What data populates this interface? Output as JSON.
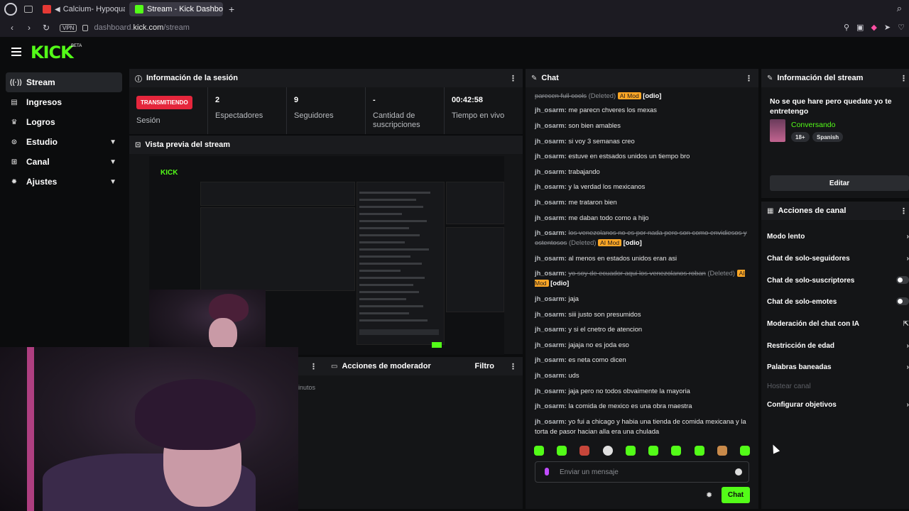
{
  "browser": {
    "tab1": "Calcium- Hypoqua",
    "tab2": "Stream - Kick Dashboard",
    "url_prefix": "dashboard.",
    "url_domain": "kick.com",
    "url_path": "/stream",
    "vpn": "VPN"
  },
  "brand": {
    "logo": "KICK",
    "beta": "BETA",
    "accent": "#53fc18"
  },
  "sidebar": {
    "items": [
      {
        "label": "Stream",
        "icon": "broadcast-icon"
      },
      {
        "label": "Ingresos",
        "icon": "income-icon"
      },
      {
        "label": "Logros",
        "icon": "trophy-icon"
      },
      {
        "label": "Estudio",
        "icon": "studio-icon"
      },
      {
        "label": "Canal",
        "icon": "channel-icon"
      },
      {
        "label": "Ajustes",
        "icon": "gear-icon"
      }
    ]
  },
  "session": {
    "title": "Información de la sesión",
    "live_badge": "TRANSMITIENDO",
    "session_label": "Sesión",
    "viewers_value": "2",
    "viewers_label": "Espectadores",
    "followers_value": "9",
    "followers_label": "Seguidores",
    "subs_value": "-",
    "subs_label": "Cantidad de suscripciones",
    "uptime_value": "00:42:58",
    "uptime_label": "Tiempo en vivo"
  },
  "preview": {
    "title": "Vista previa del stream"
  },
  "moderator": {
    "title": "Acciones de moderador",
    "filter": "Filtro",
    "partial": "inutos"
  },
  "chat": {
    "title": "Chat",
    "messages": [
      {
        "user": "",
        "text": "",
        "deleted": "parecen full cools",
        "deleted_tag": "(Deleted)",
        "aimod": "AI Mod",
        "odio": "[odio]"
      },
      {
        "user": "jh_osarm:",
        "text": "me parecn chveres los mexas"
      },
      {
        "user": "jh_osarm:",
        "text": "son bien amables"
      },
      {
        "user": "jh_osarm:",
        "text": "si voy 3 semanas creo"
      },
      {
        "user": "jh_osarm:",
        "text": "estuve en estsados unidos un tiempo bro"
      },
      {
        "user": "jh_osarm:",
        "text": "trabajando"
      },
      {
        "user": "jh_osarm:",
        "text": "y la verdad los mexicanos"
      },
      {
        "user": "jh_osarm:",
        "text": "me trataron bien"
      },
      {
        "user": "jh_osarm:",
        "text": "me daban todo como a hijo"
      },
      {
        "user": "jh_osarm:",
        "text": "",
        "deleted": "los venezolanos no es por nada pero son como envidiesos y ostentosos",
        "deleted_tag": "(Deleted)",
        "aimod": "AI Mod",
        "odio": "[odio]"
      },
      {
        "user": "jh_osarm:",
        "text": "al menos en estados unidos eran asi"
      },
      {
        "user": "jh_osarm:",
        "text": "",
        "deleted": "yo soy de ecuador aqui los venezolanos roban",
        "deleted_tag": "(Deleted)",
        "aimod": "AI Mod",
        "odio": "[odio]"
      },
      {
        "user": "jh_osarm:",
        "text": "jaja"
      },
      {
        "user": "jh_osarm:",
        "text": "siii justo son presumidos"
      },
      {
        "user": "jh_osarm:",
        "text": "y si el cnetro de atencion"
      },
      {
        "user": "jh_osarm:",
        "text": "jajaja no es joda eso"
      },
      {
        "user": "jh_osarm:",
        "text": "es neta como dicen"
      },
      {
        "user": "jh_osarm:",
        "text": "uds"
      },
      {
        "user": "jh_osarm:",
        "text": "jaja pero no todos obvaimente la mayoria"
      },
      {
        "user": "jh_osarm:",
        "text": "la comida de mexico es una obra maestra"
      },
      {
        "user": "jh_osarm:",
        "text": "yo fui a chicago y habia una tienda de comida mexicana y la torta de pasor hacian alla era una chulada"
      }
    ],
    "input_placeholder": "Enviar un mensaje",
    "send_label": "Chat"
  },
  "stream_info": {
    "title": "Información del stream",
    "stream_title": "No se que hare pero quedate yo te entretengo",
    "category": "Conversando",
    "tag_age": "18+",
    "tag_lang": "Spanish",
    "edit_label": "Editar"
  },
  "channel_actions": {
    "title": "Acciones de canal",
    "items": [
      {
        "label": "Modo lento",
        "control": "arrow"
      },
      {
        "label": "Chat de solo-seguidores",
        "control": "arrow"
      },
      {
        "label": "Chat de solo-suscriptores",
        "control": "toggle"
      },
      {
        "label": "Chat de solo-emotes",
        "control": "toggle"
      },
      {
        "label": "Moderación del chat con IA",
        "control": "arrow"
      },
      {
        "label": "Restricción de edad",
        "control": "arrow"
      },
      {
        "label": "Palabras baneadas",
        "control": "arrow"
      },
      {
        "label": "Hostear canal",
        "control": "none"
      },
      {
        "label": "Configurar objetivos",
        "control": "arrow"
      }
    ]
  },
  "mini": {
    "session": "Información de la sesión",
    "chat": "Chat",
    "info": "Información del stream"
  }
}
